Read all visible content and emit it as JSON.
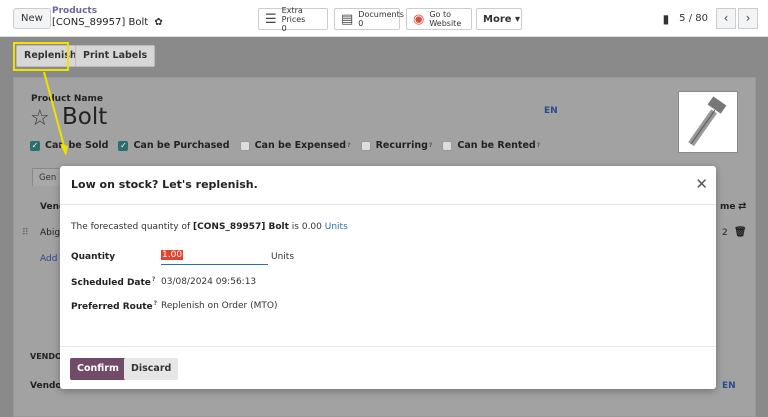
{
  "topbar": {
    "new_label": "New",
    "breadcrumb_parent": "Products",
    "breadcrumb_current": "[CONS_89957] Bolt",
    "smart_buttons": [
      {
        "label": "Extra Prices",
        "value": "0"
      },
      {
        "label": "Documents",
        "value": "0"
      },
      {
        "label": "Go to",
        "value": "Website"
      },
      {
        "label": "More"
      }
    ],
    "pager": "5 / 80"
  },
  "actions": {
    "replenish_label": "Replenish",
    "print_labels_label": "Print Labels"
  },
  "sheet": {
    "product_name_label": "Product Name",
    "product_name": "Bolt",
    "lang": "EN",
    "checkboxes": [
      {
        "label": "Can be Sold",
        "checked": true
      },
      {
        "label": "Can be Purchased",
        "checked": true
      },
      {
        "label": "Can be Expensed",
        "checked": false
      },
      {
        "label": "Recurring",
        "checked": false
      },
      {
        "label": "Can be Rented",
        "checked": false
      }
    ],
    "tab_stub": "Gen",
    "left_vend": "Vend",
    "left_abig": "Abig",
    "left_add": "Add",
    "left_vendo_caps": "VENDO",
    "left_vendo": "Vendo",
    "right_name": "me",
    "right_count": "2",
    "right_en": "EN"
  },
  "dialog": {
    "title": "Low on stock? Let's replenish.",
    "forecast_prefix": "The forecasted quantity of",
    "forecast_product": "[CONS_89957] Bolt",
    "forecast_mid": "is 0.00",
    "forecast_unit": "Units",
    "quantity_label": "Quantity",
    "quantity_value": "1.00",
    "quantity_unit": "Units",
    "scheduled_label": "Scheduled Date",
    "scheduled_value": "03/08/2024 09:56:13",
    "route_label": "Preferred Route",
    "route_value": "Replenish on Order (MTO)",
    "help_mark": "?",
    "confirm_label": "Confirm",
    "discard_label": "Discard"
  }
}
